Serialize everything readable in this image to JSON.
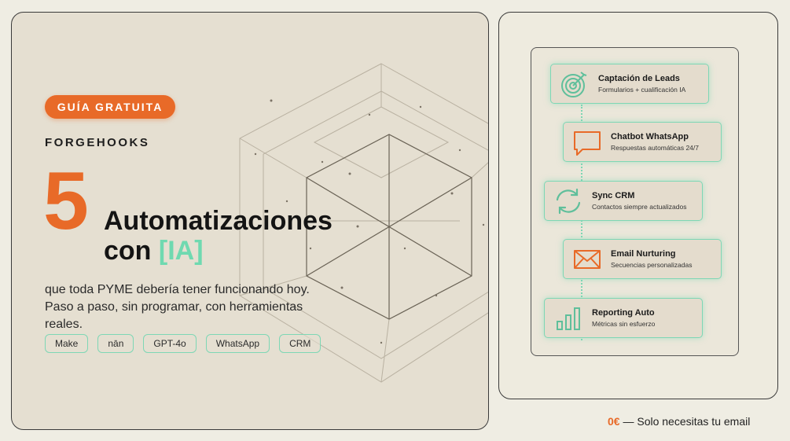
{
  "left": {
    "badge": "GUÍA GRATUITA",
    "brand": "FORGEHOOKS",
    "big_number": "5",
    "headline_line1": "Automatizaciones",
    "headline_line2_prefix": "con ",
    "headline_accent": "[IA]",
    "subtitle": "que toda PYME debería tener funcionando hoy. Paso a paso, sin programar, con herramientas reales.",
    "tags": [
      "Make",
      "nān",
      "GPT-4o",
      "WhatsApp",
      "CRM"
    ]
  },
  "features": [
    {
      "title": "Captación de Leads",
      "subtitle": "Formularios + cualificación IA",
      "icon": "target-icon"
    },
    {
      "title": "Chatbot WhatsApp",
      "subtitle": "Respuestas automáticas 24/7",
      "icon": "chat-bubble-icon"
    },
    {
      "title": "Sync CRM",
      "subtitle": "Contactos siempre actualizados",
      "icon": "sync-icon"
    },
    {
      "title": "Email Nurturing",
      "subtitle": "Secuencias personalizadas",
      "icon": "envelope-icon"
    },
    {
      "title": "Reporting Auto",
      "subtitle": "Métricas sin esfuerzo",
      "icon": "bar-chart-icon"
    }
  ],
  "footer": {
    "price": "0€",
    "text": " — Solo necesitas tu email"
  },
  "colors": {
    "accent_orange": "#e86a28",
    "accent_mint": "#7ed7b5",
    "card_beige": "#e5dfd1",
    "page_bg": "#efede3"
  }
}
